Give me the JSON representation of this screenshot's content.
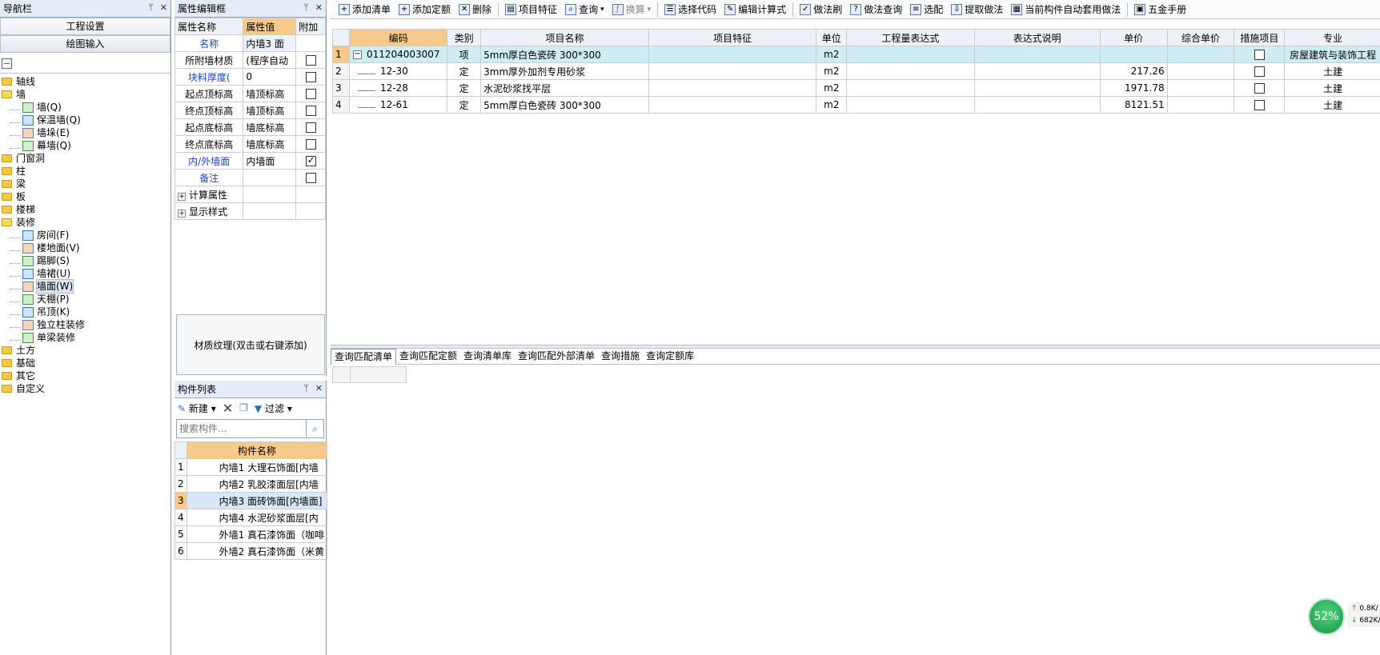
{
  "nav": {
    "title": "导航栏",
    "buttons": [
      "工程设置",
      "绘图输入"
    ],
    "tree": [
      {
        "label": "轴线",
        "level": 0,
        "icon": "folder-icon"
      },
      {
        "label": "墙",
        "level": 0,
        "icon": "folder-open-icon"
      },
      {
        "label": "墙(Q)",
        "level": 1,
        "icon": "wall-icon"
      },
      {
        "label": "保温墙(Q)",
        "level": 1,
        "icon": "insulation-wall-icon"
      },
      {
        "label": "墙垛(E)",
        "level": 1,
        "icon": "wall-pier-icon"
      },
      {
        "label": "幕墙(Q)",
        "level": 1,
        "icon": "curtain-wall-icon"
      },
      {
        "label": "门窗洞",
        "level": 0,
        "icon": "folder-icon"
      },
      {
        "label": "柱",
        "level": 0,
        "icon": "folder-icon"
      },
      {
        "label": "梁",
        "level": 0,
        "icon": "folder-icon"
      },
      {
        "label": "板",
        "level": 0,
        "icon": "folder-icon"
      },
      {
        "label": "楼梯",
        "level": 0,
        "icon": "folder-icon"
      },
      {
        "label": "装修",
        "level": 0,
        "icon": "folder-open-icon"
      },
      {
        "label": "房间(F)",
        "level": 1,
        "icon": "room-icon"
      },
      {
        "label": "楼地面(V)",
        "level": 1,
        "icon": "floor-icon"
      },
      {
        "label": "踢脚(S)",
        "level": 1,
        "icon": "skirting-icon"
      },
      {
        "label": "墙裙(U)",
        "level": 1,
        "icon": "dado-icon"
      },
      {
        "label": "墙面(W)",
        "level": 1,
        "icon": "wall-face-icon",
        "selected": true
      },
      {
        "label": "天棚(P)",
        "level": 1,
        "icon": "ceiling-icon"
      },
      {
        "label": "吊顶(K)",
        "level": 1,
        "icon": "suspended-ceiling-icon"
      },
      {
        "label": "独立柱装修",
        "level": 1,
        "icon": "column-decor-icon"
      },
      {
        "label": "单梁装修",
        "level": 1,
        "icon": "beam-decor-icon"
      },
      {
        "label": "土方",
        "level": 0,
        "icon": "folder-icon"
      },
      {
        "label": "基础",
        "level": 0,
        "icon": "folder-icon"
      },
      {
        "label": "其它",
        "level": 0,
        "icon": "folder-icon"
      },
      {
        "label": "自定义",
        "level": 0,
        "icon": "folder-icon"
      }
    ]
  },
  "prop": {
    "title": "属性编辑框",
    "headers": [
      "属性名称",
      "属性值",
      "附加"
    ],
    "rows": [
      {
        "name": "名称",
        "value": "内墙3 面",
        "blue": true,
        "check": null,
        "selected": true
      },
      {
        "name": "所附墙材质",
        "value": "(程序自动",
        "blue": false,
        "check": false
      },
      {
        "name": "块料厚度(",
        "value": "0",
        "blue": true,
        "check": false
      },
      {
        "name": "起点顶标高",
        "value": "墙顶标高",
        "blue": false,
        "check": false
      },
      {
        "name": "终点顶标高",
        "value": "墙顶标高",
        "blue": false,
        "check": false
      },
      {
        "name": "起点底标高",
        "value": "墙底标高",
        "blue": false,
        "check": false
      },
      {
        "name": "终点底标高",
        "value": "墙底标高",
        "blue": false,
        "check": false
      },
      {
        "name": "内/外墙面",
        "value": "内墙面",
        "blue": true,
        "check": true
      },
      {
        "name": "备注",
        "value": "",
        "blue": true,
        "check": false
      }
    ],
    "groups": [
      "计算属性",
      "显示样式"
    ],
    "material_text": "材质纹理(双击或右键添加)"
  },
  "comp": {
    "title": "构件列表",
    "new_label": "新建",
    "filter_label": "过滤",
    "search_placeholder": "搜索构件...",
    "header": "构件名称",
    "rows": [
      {
        "n": "1",
        "name": "内墙1 大理石饰面[内墙"
      },
      {
        "n": "2",
        "name": "内墙2 乳胶漆面层[内墙"
      },
      {
        "n": "3",
        "name": "内墙3 面砖饰面[内墙面]",
        "selected": true
      },
      {
        "n": "4",
        "name": "内墙4 水泥砂浆面层[内"
      },
      {
        "n": "5",
        "name": "外墙1 真石漆饰面（咖啡"
      },
      {
        "n": "6",
        "name": "外墙2 真石漆饰面（米黄"
      }
    ]
  },
  "toolbar": {
    "items": [
      {
        "label": "添加清单",
        "icon": "add-list-icon"
      },
      {
        "label": "添加定额",
        "icon": "add-quota-icon"
      },
      {
        "label": "删除",
        "icon": "delete-icon"
      },
      {
        "label": "项目特征",
        "icon": "feature-icon"
      },
      {
        "label": "查询",
        "icon": "search-icon",
        "dropdown": true
      },
      {
        "label": "换算",
        "icon": "fx-icon",
        "dropdown": true,
        "disabled": true
      },
      {
        "label": "选择代码",
        "icon": "select-code-icon"
      },
      {
        "label": "编辑计算式",
        "icon": "edit-formula-icon"
      },
      {
        "label": "做法刷",
        "icon": "brush-icon"
      },
      {
        "label": "做法查询",
        "icon": "method-query-icon"
      },
      {
        "label": "选配",
        "icon": "match-icon"
      },
      {
        "label": "提取做法",
        "icon": "extract-icon"
      },
      {
        "label": "当前构件自动套用做法",
        "icon": "auto-apply-icon"
      },
      {
        "label": "五金手册",
        "icon": "manual-icon"
      }
    ]
  },
  "grid": {
    "headers": [
      "编码",
      "类别",
      "项目名称",
      "项目特征",
      "单位",
      "工程量表达式",
      "表达式说明",
      "单价",
      "综合单价",
      "措施项目",
      "专业"
    ],
    "rows": [
      {
        "n": "1",
        "code": "011204003007",
        "type": "项",
        "name": "5mm厚白色瓷砖 300*300",
        "feature": "",
        "unit": "m2",
        "expr": "",
        "desc": "",
        "price": "",
        "total": "",
        "measure": false,
        "major": "房屋建筑与装饰工程",
        "top": true
      },
      {
        "n": "2",
        "code": "12-30",
        "type": "定",
        "name": "3mm厚外加剂专用砂浆",
        "feature": "",
        "unit": "m2",
        "expr": "",
        "desc": "",
        "price": "217.26",
        "total": "",
        "measure": false,
        "major": "土建"
      },
      {
        "n": "3",
        "code": "12-28",
        "type": "定",
        "name": "水泥砂浆找平层",
        "feature": "",
        "unit": "m2",
        "expr": "",
        "desc": "",
        "price": "1971.78",
        "total": "",
        "measure": false,
        "major": "土建"
      },
      {
        "n": "4",
        "code": "12-61",
        "type": "定",
        "name": "5mm厚白色瓷砖 300*300",
        "feature": "",
        "unit": "m2",
        "expr": "",
        "desc": "",
        "price": "8121.51",
        "total": "",
        "measure": false,
        "major": "土建"
      }
    ]
  },
  "bottom_tabs": [
    "查询匹配清单",
    "查询匹配定额",
    "查询清单库",
    "查询匹配外部清单",
    "查询措施",
    "查询定额库"
  ],
  "widget": {
    "percent": "52%",
    "up": "0.8K/",
    "down": "682K/"
  },
  "colors": {
    "header_accent": "#f7c98a",
    "row_highlight": "#cfeef4",
    "link_blue": "#1e44c9"
  }
}
